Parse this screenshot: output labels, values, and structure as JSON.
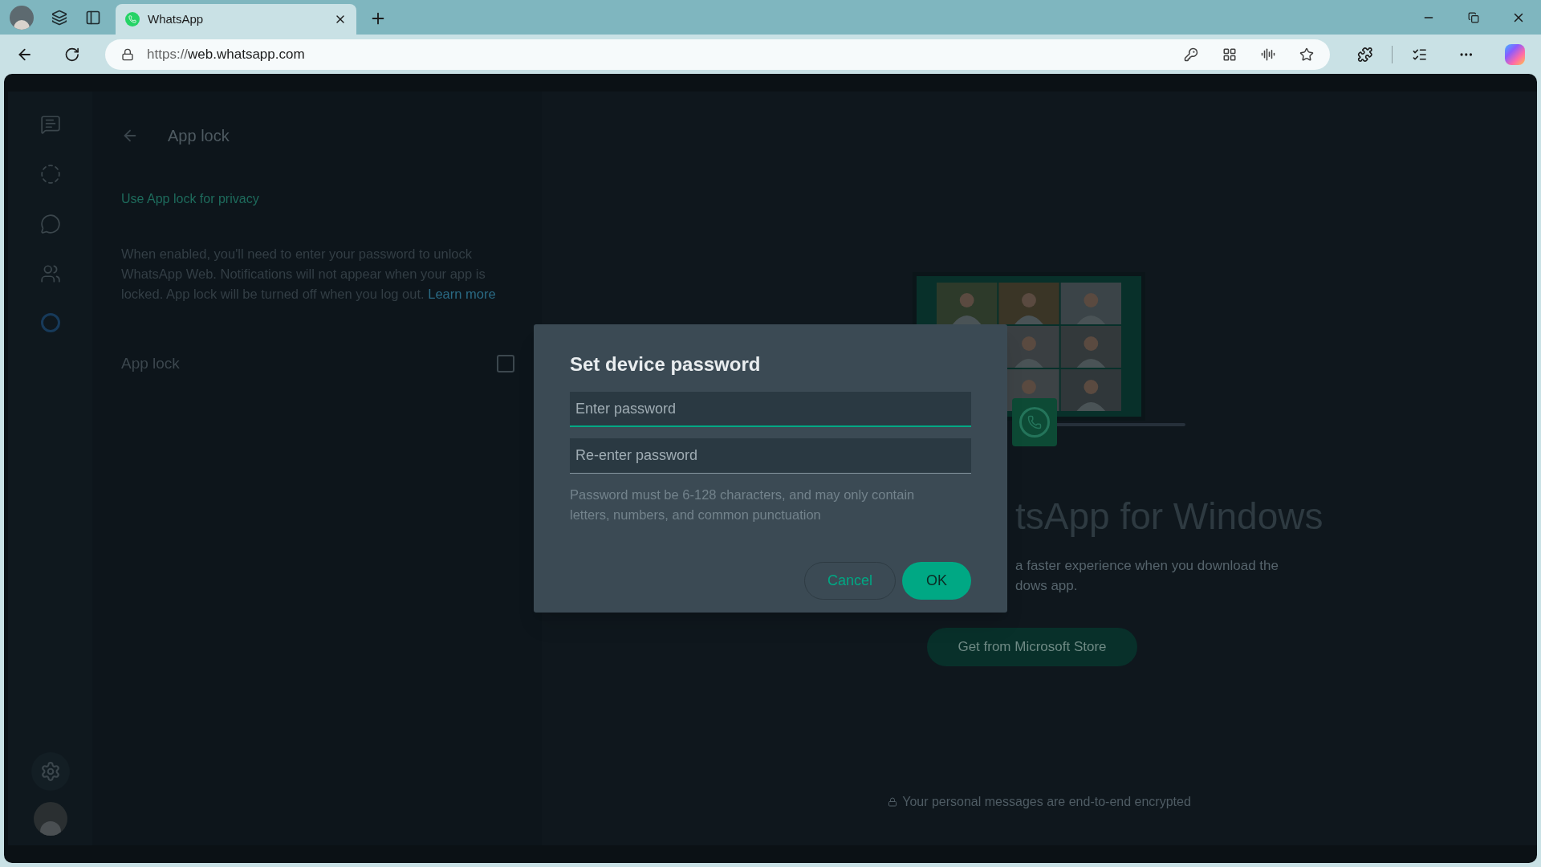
{
  "browser": {
    "tabs": [
      {
        "title": "WhatsApp",
        "selected": true
      }
    ],
    "address": {
      "scheme": "https://",
      "host": "web.whatsapp.com"
    }
  },
  "settings_panel": {
    "title": "App lock",
    "section_heading": "Use App lock for privacy",
    "description": "When enabled, you'll need to enter your password to unlock WhatsApp Web. Notifications will not appear when your app is locked. App lock will be turned off when you log out.",
    "learn_more_link": "Learn more",
    "option": {
      "label": "App lock",
      "checked": false
    }
  },
  "welcome": {
    "title": "tsApp for Windows",
    "subtitle_lines": [
      "a faster experience when you download the",
      "dows app."
    ],
    "store_button": "Get from Microsoft Store",
    "footer": "Your personal messages are end-to-end encrypted"
  },
  "dialog": {
    "title": "Set device password",
    "fields": [
      {
        "placeholder": "Enter password",
        "focused": true
      },
      {
        "placeholder": "Re-enter password",
        "focused": false
      }
    ],
    "hint": "Password must be 6-128 characters, and may only contain letters, numbers, and common punctuation",
    "buttons": [
      {
        "label": "Cancel",
        "kind": "secondary"
      },
      {
        "label": "OK",
        "kind": "primary"
      }
    ]
  }
}
